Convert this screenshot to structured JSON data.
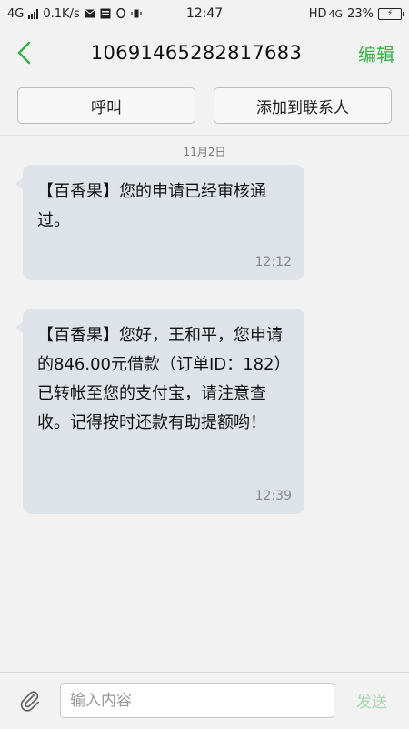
{
  "status_bar": {
    "network_left": "4G",
    "speed": "0.1K/s",
    "time": "12:47",
    "hd": "HD",
    "network_right": "4G",
    "battery_percent": "23%",
    "icons": [
      "signal-icon",
      "sms-notification-icon",
      "news-notification-icon",
      "qq-notification-icon",
      "vibrate-icon",
      "charging-battery-icon"
    ]
  },
  "header": {
    "back_icon": "chevron-left-icon",
    "title": "10691465282817683",
    "edit_label": "编辑",
    "accent_color": "#3db14a"
  },
  "actions": {
    "call_label": "呼叫",
    "add_contact_label": "添加到联系人"
  },
  "conversation": {
    "date": "11月2日",
    "messages": [
      {
        "text": "【百香果】您的申请已经审核通过。",
        "time": "12:12"
      },
      {
        "text": "【百香果】您好，王和平，您申请的846.00元借款（订单ID：182）已转帐至您的支付宝，请注意查收。记得按时还款有助提额哟！",
        "time": "12:39"
      }
    ]
  },
  "composer": {
    "attach_icon": "paperclip-icon",
    "value": "",
    "placeholder": "输入内容",
    "send_label": "发送"
  }
}
